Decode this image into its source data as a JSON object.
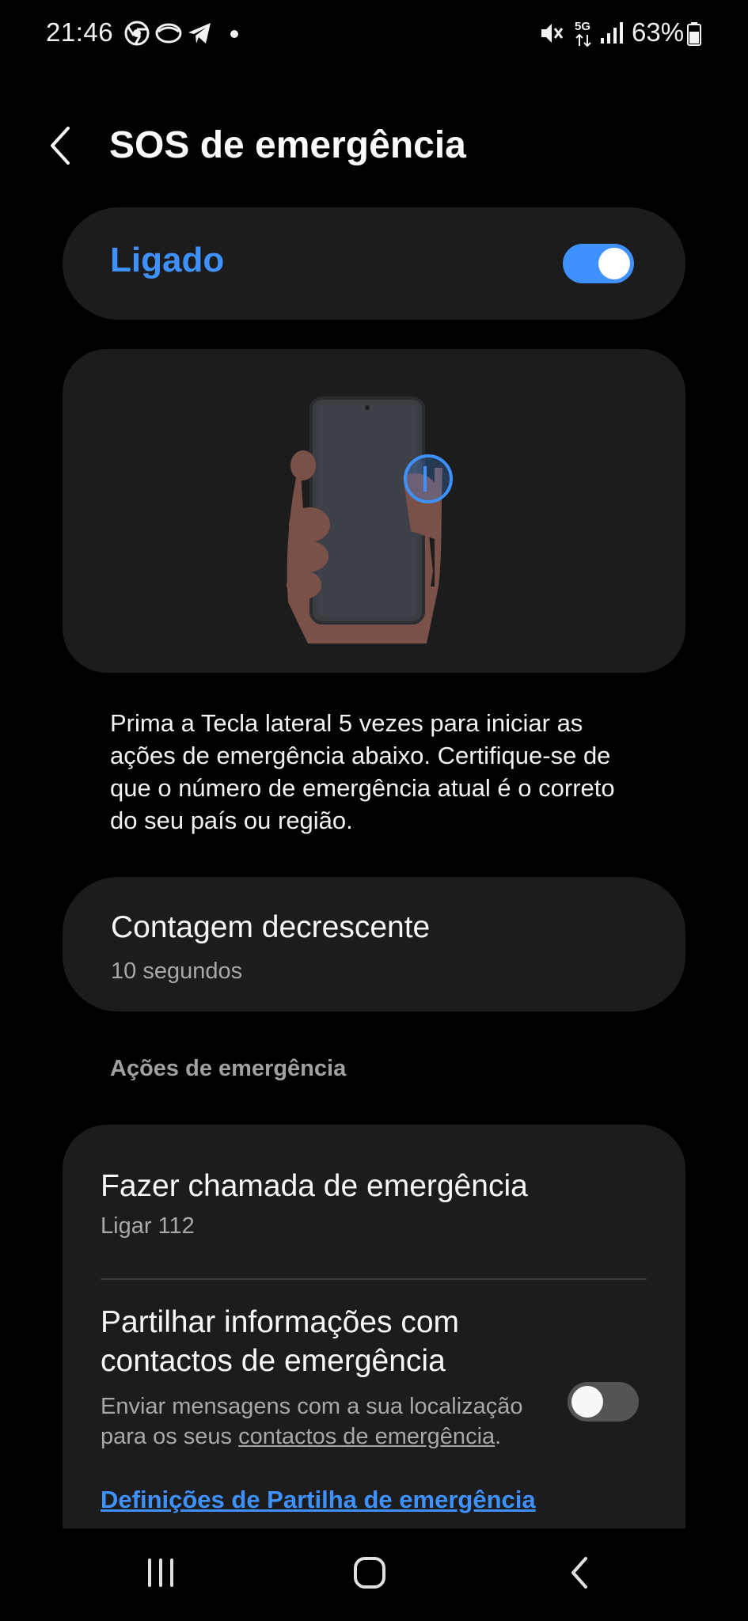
{
  "status_bar": {
    "time": "21:46",
    "battery": "63%",
    "network": "5G",
    "icons": [
      "chrome-icon",
      "cloud-icon",
      "telegram-icon",
      "dot-icon",
      "mute-icon",
      "5g-icon",
      "signal-icon",
      "battery-icon"
    ]
  },
  "header": {
    "title": "SOS de emergência"
  },
  "master": {
    "label": "Ligado",
    "enabled": true
  },
  "description": "Prima a Tecla lateral 5 vezes para iniciar as ações de emergência abaixo. Certifique-se de que o número de emergência atual é o correto do seu país ou região.",
  "countdown": {
    "title": "Contagem decrescente",
    "value": "10 segundos"
  },
  "section": {
    "title": "Ações de emergência"
  },
  "actions": {
    "call": {
      "title": "Fazer chamada de emergência",
      "subtitle": "Ligar 112"
    },
    "share": {
      "title_line1": "Partilhar informações com",
      "title_line2": "contactos de emergência",
      "desc_prefix": "Enviar mensagens com a sua localização para os seus ",
      "desc_link": "contactos de emergência",
      "desc_suffix": ".",
      "enabled": false
    },
    "settings_link": "Definições de Partilha de emergência"
  },
  "colors": {
    "accent": "#3e91ff",
    "card_bg": "#1c1c1c",
    "background": "#000000"
  },
  "nav": {
    "buttons": [
      "recent-apps-icon",
      "home-icon",
      "back-icon"
    ]
  }
}
